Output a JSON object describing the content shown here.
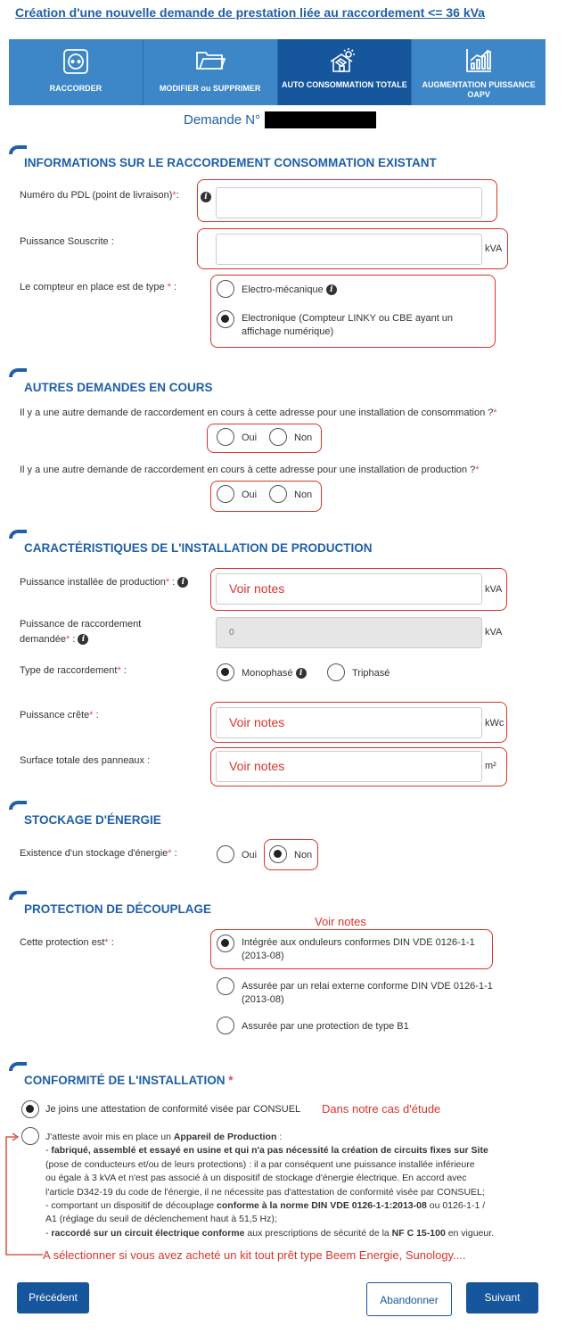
{
  "page_title": "Création d'une nouvelle demande de prestation liée au raccordement <= 36 kVa",
  "tabs": [
    {
      "label": "RACCORDER",
      "icon": "socket-icon"
    },
    {
      "label": "MODIFIER ou SUPPRIMER",
      "icon": "folder-icon"
    },
    {
      "label": "AUTO CONSOMMATION TOTALE",
      "icon": "solar-house-icon"
    },
    {
      "label": "AUGMENTATION PUISSANCE OAPV",
      "icon": "bar-chart-icon"
    }
  ],
  "demande_label": "Demande N°",
  "s1": {
    "title": "INFORMATIONS SUR LE RACCORDEMENT CONSOMMATION EXISTANT",
    "pdl_label": "Numéro du PDL (point de livraison)",
    "pdl_value": "",
    "puissance_label": "Puissance Souscrite :",
    "puissance_value": "",
    "puissance_unit": "kVA",
    "compteur_label": "Le compteur en place est de type",
    "compteur_opt1": "Electro-mécanique",
    "compteur_opt2_line1": "Electronique (Compteur LINKY ou CBE ayant un",
    "compteur_opt2_line2": "affichage numérique)"
  },
  "s2": {
    "title": "AUTRES DEMANDES EN COURS",
    "q1": "Il y a une autre demande de raccordement en cours à cette adresse pour une installation de consommation ?",
    "q2": "Il y a une autre demande de raccordement en cours à cette adresse pour une installation de production ?",
    "oui": "Oui",
    "non": "Non"
  },
  "s3": {
    "title": "CARACTÉRISTIQUES DE L'INSTALLATION DE PRODUCTION",
    "p_install_label": "Puissance installée de production",
    "p_install_value": "Voir notes",
    "kva": "kVA",
    "p_racc_label_1": "Puissance de raccordement",
    "p_racc_label_2": "demandée",
    "p_racc_value": "0",
    "type_label": "Type de raccordement",
    "mono": "Monophasé",
    "tri": "Triphasé",
    "crete_label": "Puissance crête",
    "crete_value": "Voir notes",
    "kwc": "kWc",
    "surface_label": "Surface totale des panneaux :",
    "surface_value": "Voir notes",
    "m2": "m²"
  },
  "s4": {
    "title": "STOCKAGE D'ÉNERGIE",
    "label": "Existence d'un stockage d'énergie",
    "oui": "Oui",
    "non": "Non"
  },
  "s5": {
    "title": "PROTECTION DE DÉCOUPLAGE",
    "note": "Voir notes",
    "label": "Cette protection est",
    "opt1_l1": "Intégrée aux onduleurs conformes DIN VDE 0126-1-1",
    "opt1_l2": "(2013-08)",
    "opt2_l1": "Assurée par un relai externe conforme DIN VDE 0126-1-1",
    "opt2_l2": "(2013-08)",
    "opt3": "Assurée par une protection de type B1"
  },
  "s6": {
    "title": "CONFORMITÉ DE L'INSTALLATION",
    "opt1": "Je joins une attestation de conformité visée par CONSUEL",
    "opt1_note": "Dans notre cas d'étude",
    "opt2_intro": "J'atteste avoir mis en place un",
    "opt2_intro_bold": "Appareil de Production",
    "opt2_intro_end": " :",
    "l1_bold": "fabriqué, assemblé et essayé en usine et qui n'a pas nécessité la création de circuits fixes sur Site",
    "l2": "(pose de conducteurs et/ou de leurs protections) : il a par conséquent une puissance installée inférieure",
    "l3": "ou égale à 3 kVA et n'est pas associé à un dispositif de stockage d'énergie électrique. En accord avec",
    "l4": "l'article D342-19 du code de l'énergie, il ne nécessite pas d'attestation de conformité visée par CONSUEL;",
    "l5_a": "- comportant un dispositif de découplage ",
    "l5_bold": "conforme à la norme DIN VDE 0126-1-1:2013-08",
    "l5_b": " ou 0126-1-1 /",
    "l6": "A1 (réglage du seuil de déclenchement haut à 51,5 Hz);",
    "l7_bold": "raccordé sur un circuit électrique conforme",
    "l7_b": " aux prescriptions de sécurité de la ",
    "l7_bold2": "NF C 15-100",
    "l7_c": " en vigueur.",
    "annotation": "A sélectionner si vous avez acheté un kit tout prêt type Beem Energie, Sunology...."
  },
  "buttons": {
    "prev": "Précédent",
    "cancel": "Abandonner",
    "next": "Suivant"
  },
  "colors": {
    "primary": "#16569d",
    "tab_bg": "#3d86c8",
    "annotation_red": "#d9342b"
  }
}
